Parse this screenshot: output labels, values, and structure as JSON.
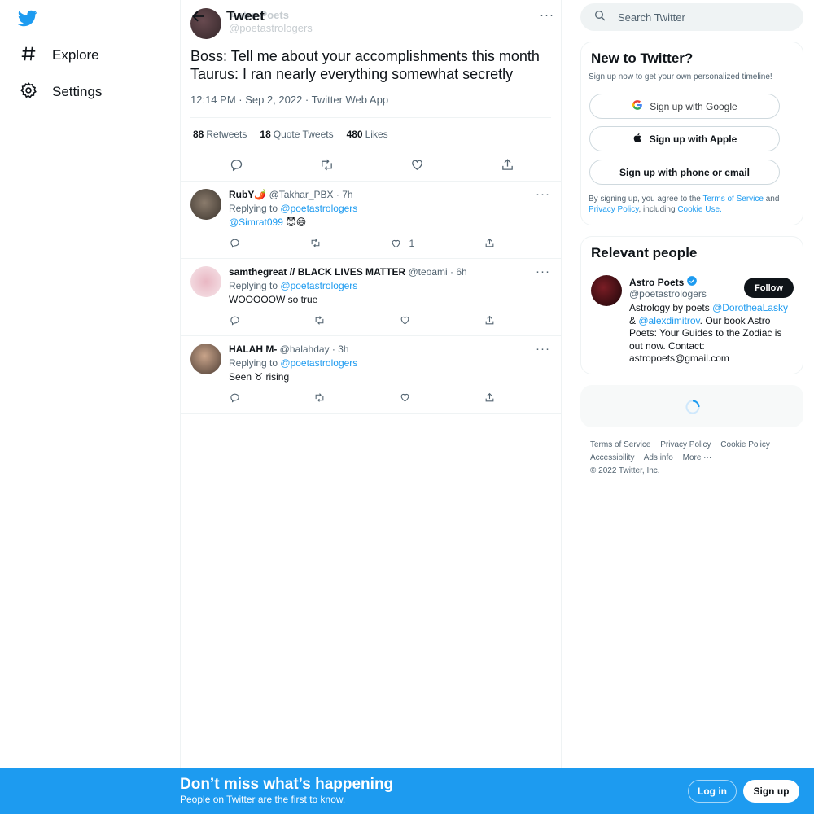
{
  "colors": {
    "brand": "#1d9bf0",
    "text": "#0f1419",
    "muted": "#536471",
    "border": "#eff3f4"
  },
  "nav": {
    "logo_icon": "twitter-bird-icon",
    "items": [
      {
        "label": "Explore",
        "icon": "hashtag-icon"
      },
      {
        "label": "Settings",
        "icon": "gear-icon"
      }
    ]
  },
  "header": {
    "title": "Tweet",
    "back_icon": "arrow-left-icon"
  },
  "tweet": {
    "author_name": "Astro Poets",
    "author_handle": "@poetastrologers",
    "text": "Boss: Tell me about your accomplishments this month\nTaurus: I ran nearly everything somewhat secretly",
    "meta": "12:14 PM · Sep 2, 2022 · Twitter Web App",
    "stats": [
      {
        "count": "88",
        "label": "Retweets"
      },
      {
        "count": "18",
        "label": "Quote Tweets"
      },
      {
        "count": "480",
        "label": "Likes"
      }
    ]
  },
  "replies": [
    {
      "name": "RubY🌶️",
      "handle": "@Takhar_PBX",
      "time": "· 7h",
      "replying_prefix": "Replying to",
      "replying_to": "@poetastrologers",
      "mention": "@Simrat099",
      "text": " 😈😅",
      "likes": "1"
    },
    {
      "name": "samthegreat // BLACK LIVES MATTER",
      "handle": "@teoami",
      "time": "· 6h",
      "replying_prefix": "Replying to",
      "replying_to": "@poetastrologers",
      "mention": "",
      "text": "WOOOOOW so true",
      "likes": ""
    },
    {
      "name": "HALAH M-",
      "handle": "@halahday",
      "time": "· 3h",
      "replying_prefix": "Replying to",
      "replying_to": "@poetastrologers",
      "mention": "",
      "text": "Seen ♉ rising",
      "likes": ""
    }
  ],
  "search": {
    "placeholder": "Search Twitter",
    "icon": "search-icon"
  },
  "new_to_twitter": {
    "title": "New to Twitter?",
    "subtitle": "Sign up now to get your own personalized timeline!",
    "google": "Sign up with Google",
    "apple": "Sign up with Apple",
    "phone": "Sign up with phone or email",
    "legal_prefix": "By signing up, you agree to the ",
    "terms": "Terms of Service",
    "and": " and ",
    "privacy": "Privacy Policy",
    "including": ", including ",
    "cookie": "Cookie Use."
  },
  "relevant": {
    "title": "Relevant people",
    "name": "Astro Poets",
    "handle": "@poetastrologers",
    "follow": "Follow",
    "bio_1": "Astrology by poets ",
    "bio_link1": "@DorotheaLasky",
    "bio_2": " & ",
    "bio_link2": "@alexdimitrov",
    "bio_3": ". Our book Astro Poets: Your Guides to the Zodiac is out now. Contact: astropoets@gmail.com"
  },
  "footer": {
    "links": [
      "Terms of Service",
      "Privacy Policy",
      "Cookie Policy",
      "Accessibility",
      "Ads info",
      "More ···"
    ],
    "copyright": "© 2022 Twitter, Inc."
  },
  "bottom_bar": {
    "title": "Don’t miss what’s happening",
    "subtitle": "People on Twitter are the first to know.",
    "login": "Log in",
    "signup": "Sign up"
  }
}
